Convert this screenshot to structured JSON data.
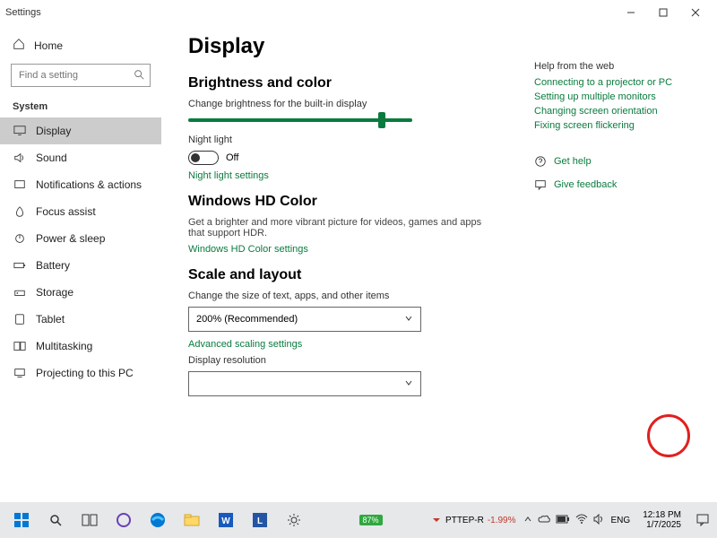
{
  "titlebar": {
    "app": "Settings"
  },
  "sidebar": {
    "home": "Home",
    "search_placeholder": "Find a setting",
    "category": "System",
    "items": [
      {
        "label": "Display"
      },
      {
        "label": "Sound"
      },
      {
        "label": "Notifications & actions"
      },
      {
        "label": "Focus assist"
      },
      {
        "label": "Power & sleep"
      },
      {
        "label": "Battery"
      },
      {
        "label": "Storage"
      },
      {
        "label": "Tablet"
      },
      {
        "label": "Multitasking"
      },
      {
        "label": "Projecting to this PC"
      }
    ]
  },
  "content": {
    "title": "Display",
    "brightness": {
      "heading": "Brightness and color",
      "label": "Change brightness for the built-in display"
    },
    "nightlight": {
      "label": "Night light",
      "state": "Off",
      "settings": "Night light settings"
    },
    "hdcolor": {
      "heading": "Windows HD Color",
      "desc": "Get a brighter and more vibrant picture for videos, games and apps that support HDR.",
      "link": "Windows HD Color settings"
    },
    "scale": {
      "heading": "Scale and layout",
      "label": "Change the size of text, apps, and other items",
      "value": "200% (Recommended)",
      "adv": "Advanced scaling settings",
      "res_label": "Display resolution"
    }
  },
  "help": {
    "heading": "Help from the web",
    "links": [
      "Connecting to a projector or PC",
      "Setting up multiple monitors",
      "Changing screen orientation",
      "Fixing screen flickering"
    ],
    "gethelp": "Get help",
    "feedback": "Give feedback"
  },
  "taskbar": {
    "battery": "87%",
    "stock_name": "PTTEP-R",
    "stock_change": "-1.99%",
    "lang": "ENG",
    "time": "12:18 PM",
    "date": "1/7/2025"
  }
}
